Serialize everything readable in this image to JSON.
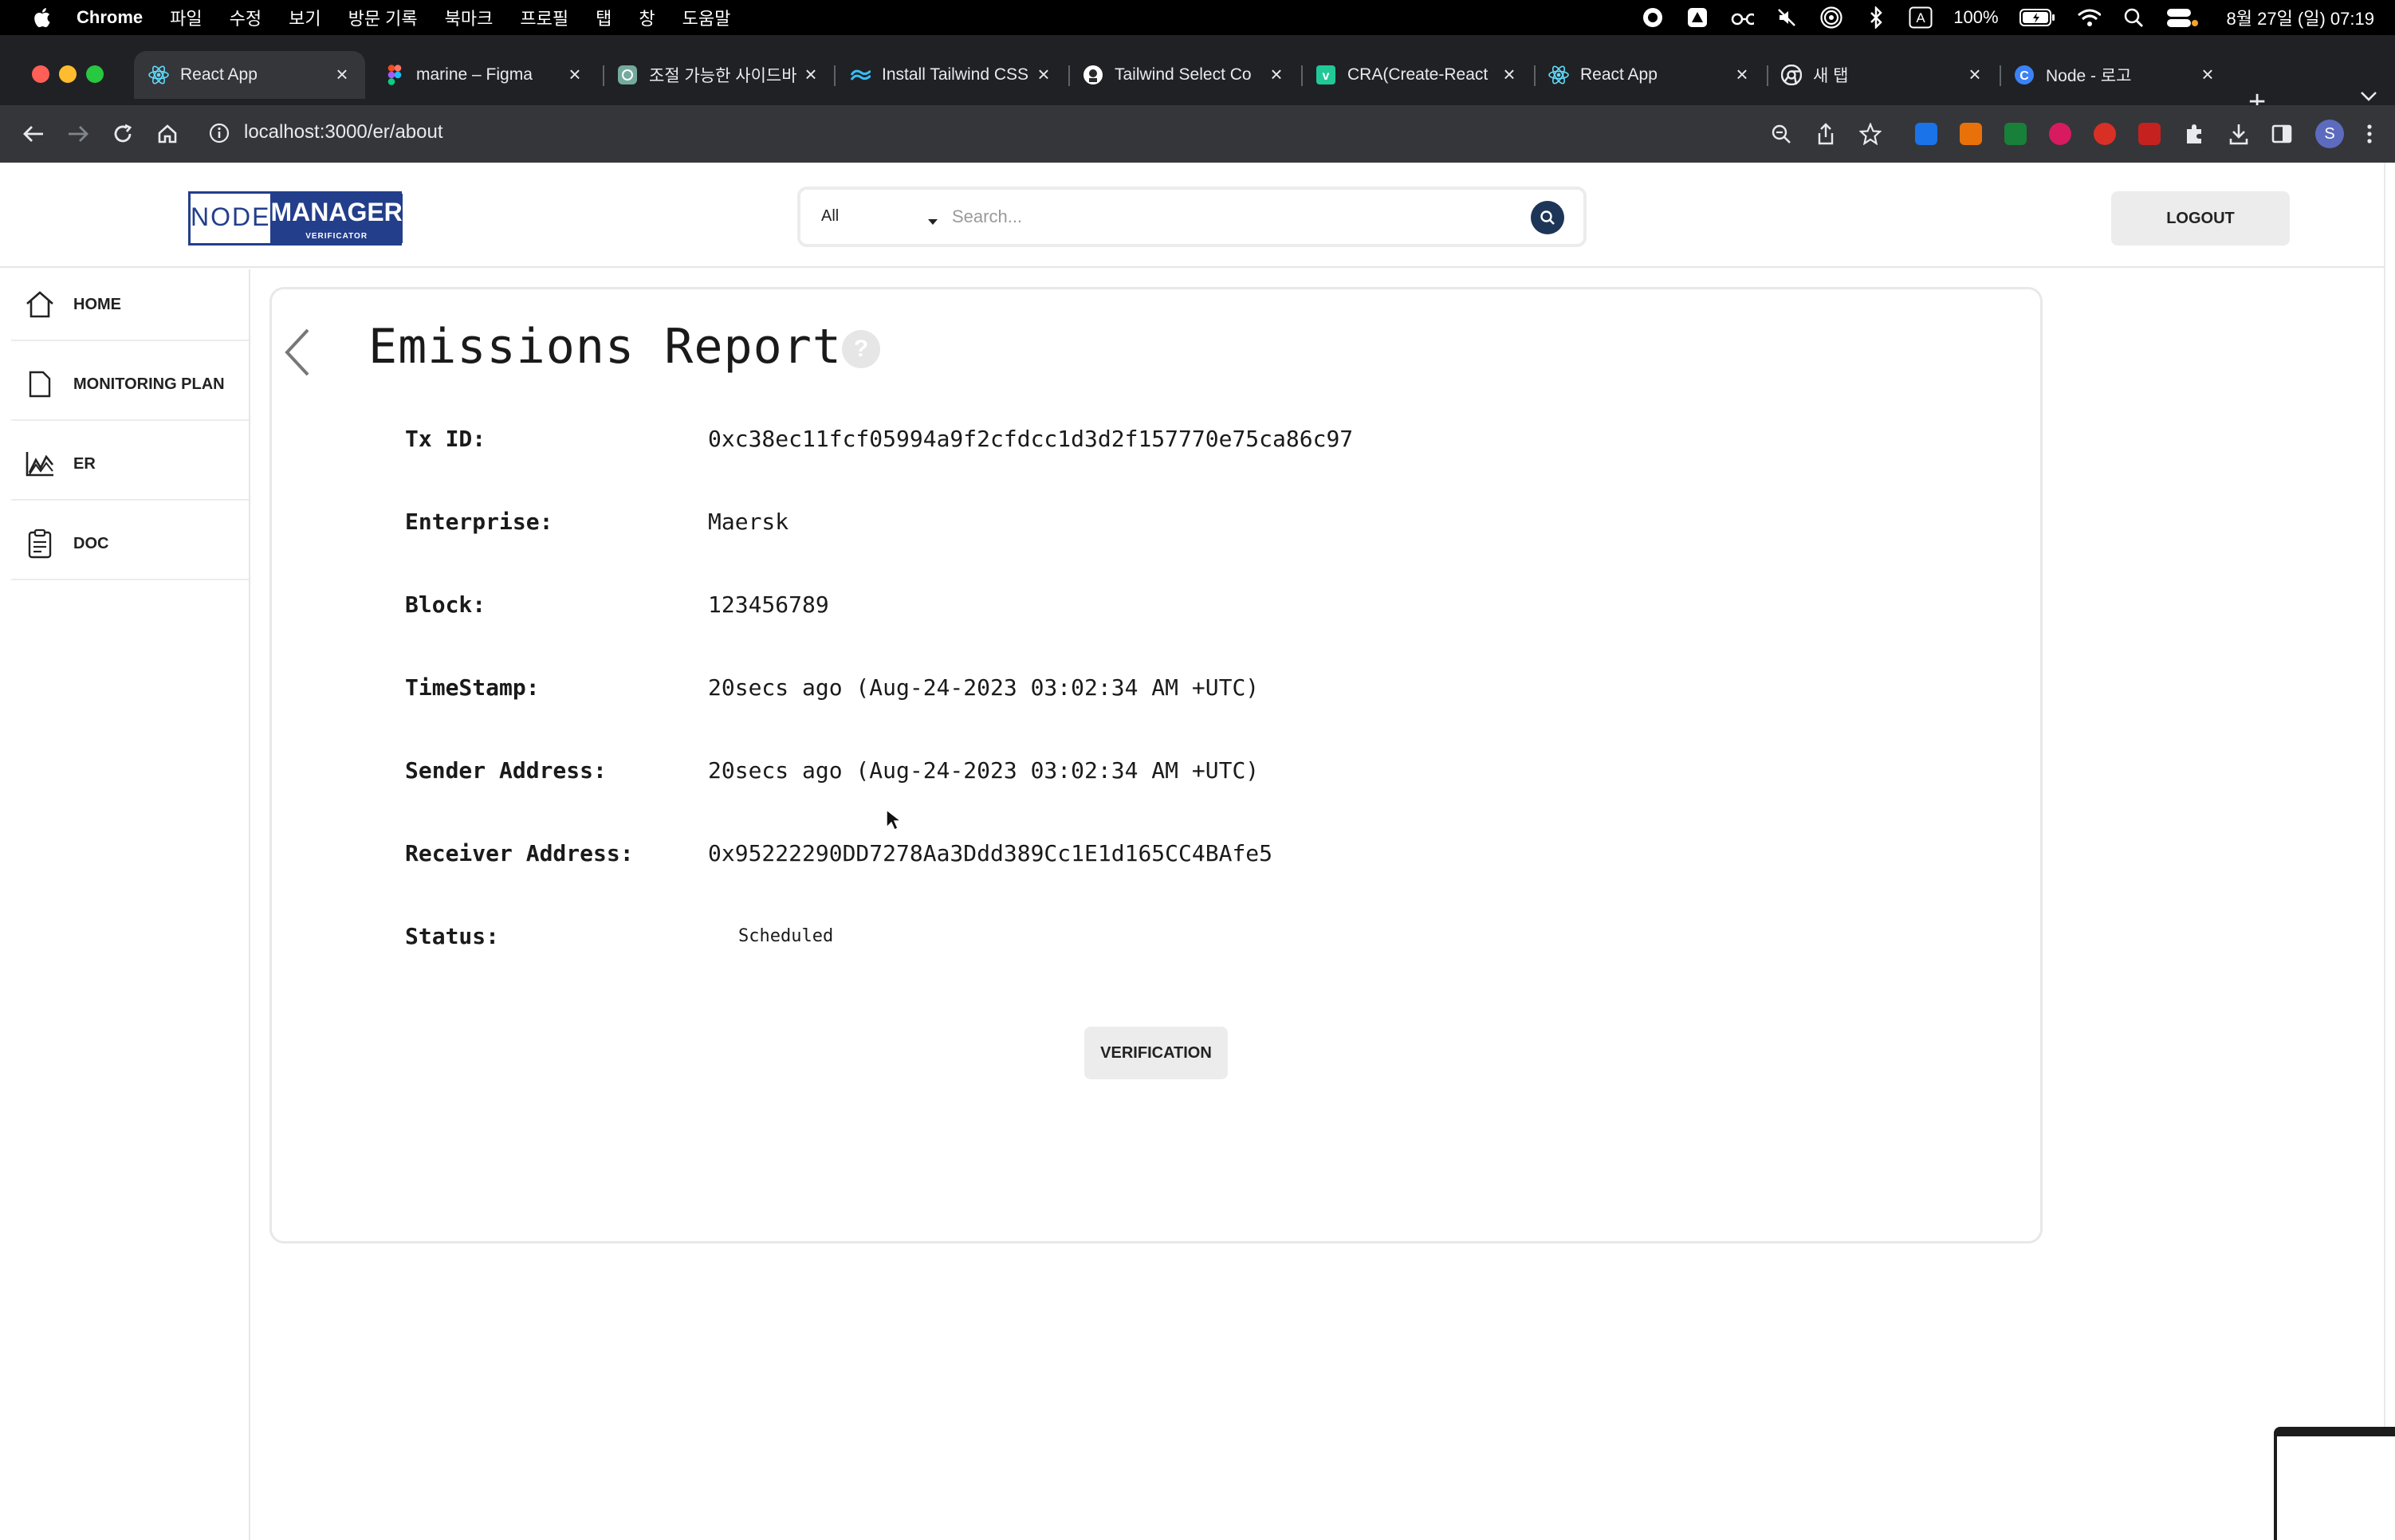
{
  "menubar": {
    "app_name": "Chrome",
    "menus": [
      "파일",
      "수정",
      "보기",
      "방문 기록",
      "북마크",
      "프로필",
      "탭",
      "창",
      "도움말"
    ],
    "input_mode": "A",
    "battery": "100%",
    "clock": "8월 27일 (일) 07:19"
  },
  "tabs": [
    {
      "title": "React App",
      "active": true
    },
    {
      "title": "marine – Figma",
      "active": false
    },
    {
      "title": "조절 가능한 사이드바",
      "active": false
    },
    {
      "title": "Install Tailwind CSS",
      "active": false
    },
    {
      "title": "Tailwind Select Co",
      "active": false
    },
    {
      "title": "CRA(Create-React",
      "active": false
    },
    {
      "title": "React App",
      "active": false
    },
    {
      "title": "새 탭",
      "active": false
    },
    {
      "title": "Node - 로고",
      "active": false
    }
  ],
  "toolbar": {
    "url": "localhost:3000/er/about",
    "profile_initial": "S"
  },
  "header": {
    "logo": {
      "node": "NODE",
      "manager": "MANAGER",
      "sub": "VERIFICATOR"
    },
    "search": {
      "category": "All",
      "placeholder": "Search..."
    },
    "logout_label": "LOGOUT"
  },
  "sidebar": {
    "items": [
      {
        "label": "HOME",
        "icon": "home-icon"
      },
      {
        "label": "MONITORING PLAN",
        "icon": "document-icon"
      },
      {
        "label": "ER",
        "icon": "chart-icon"
      },
      {
        "label": "DOC",
        "icon": "clipboard-icon"
      }
    ]
  },
  "report": {
    "title": "Emissions Report",
    "help": "?",
    "rows": [
      {
        "label": "Tx ID:",
        "value": "0xc38ec11fcf05994a9f2cfdcc1d3d2f157770e75ca86c97"
      },
      {
        "label": "Enterprise:",
        "value": "Maersk"
      },
      {
        "label": "Block:",
        "value": "123456789"
      },
      {
        "label": "TimeStamp:",
        "value": "20secs ago (Aug-24-2023 03:02:34 AM +UTC)"
      },
      {
        "label": "Sender Address:",
        "value": "20secs ago (Aug-24-2023 03:02:34 AM +UTC)"
      },
      {
        "label": "Receiver Address:",
        "value": "0x95222290DD7278Aa3Ddd389Cc1E1d165CC4BAfe5"
      }
    ],
    "status": {
      "label": "Status:",
      "value": "Scheduled"
    },
    "verify_label": "VERIFICATION"
  }
}
